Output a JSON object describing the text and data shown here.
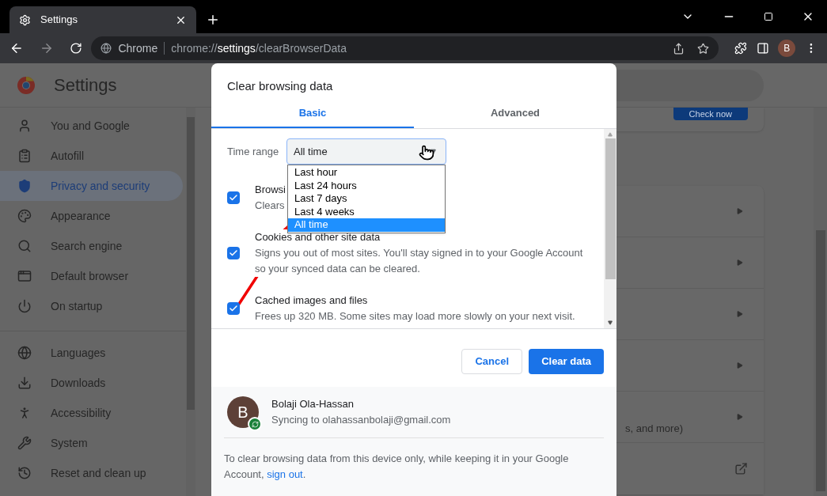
{
  "browser": {
    "tab_title": "Settings",
    "omnibox": {
      "site": "Chrome",
      "url": "chrome://**settings**/clearBrowserData"
    },
    "profile_initial": "B"
  },
  "settings_page": {
    "title": "Settings",
    "check_now_button": "Check now",
    "rows": [
      {
        "subtitle": ""
      },
      {
        "subtitle": ""
      },
      {
        "subtitle": ""
      },
      {
        "subtitle": ""
      },
      {
        "subtitle": "s, and more)"
      }
    ],
    "sidebar": {
      "groups": [
        [
          {
            "label": "You and Google",
            "selected": false
          },
          {
            "label": "Autofill",
            "selected": false
          },
          {
            "label": "Privacy and security",
            "selected": true
          },
          {
            "label": "Appearance",
            "selected": false
          },
          {
            "label": "Search engine",
            "selected": false
          },
          {
            "label": "Default browser",
            "selected": false
          },
          {
            "label": "On startup",
            "selected": false
          }
        ],
        [
          {
            "label": "Languages",
            "selected": false
          },
          {
            "label": "Downloads",
            "selected": false
          },
          {
            "label": "Accessibility",
            "selected": false
          },
          {
            "label": "System",
            "selected": false
          },
          {
            "label": "Reset and clean up",
            "selected": false
          }
        ]
      ]
    }
  },
  "dialog": {
    "title": "Clear browsing data",
    "tabs": [
      {
        "label": "Basic",
        "selected": true
      },
      {
        "label": "Advanced",
        "selected": false
      }
    ],
    "time_range": {
      "label": "Time range",
      "value": "All time",
      "options": [
        {
          "label": "Last hour",
          "selected": false
        },
        {
          "label": "Last 24 hours",
          "selected": false
        },
        {
          "label": "Last 7 days",
          "selected": false
        },
        {
          "label": "Last 4 weeks",
          "selected": false
        },
        {
          "label": "All time",
          "selected": true
        }
      ]
    },
    "items": [
      {
        "title": "Browsi",
        "description": "Clears",
        "checked": true
      },
      {
        "title": "Cookies and other site data",
        "description": "Signs you out of most sites. You'll stay signed in to your Google Account so your synced data can be cleared.",
        "checked": true
      },
      {
        "title": "Cached images and files",
        "description": "Frees up 320 MB. Some sites may load more slowly on your next visit.",
        "checked": true
      }
    ],
    "buttons": {
      "cancel": "Cancel",
      "confirm": "Clear data"
    },
    "account": {
      "initial": "B",
      "name": "Bolaji Ola-Hassan",
      "status": "Syncing to olahassanbolaji@gmail.com"
    },
    "note": {
      "text": "To clear browsing data from this device only, while keeping it in your Google Account, ",
      "link": "sign out",
      "end": "."
    }
  }
}
